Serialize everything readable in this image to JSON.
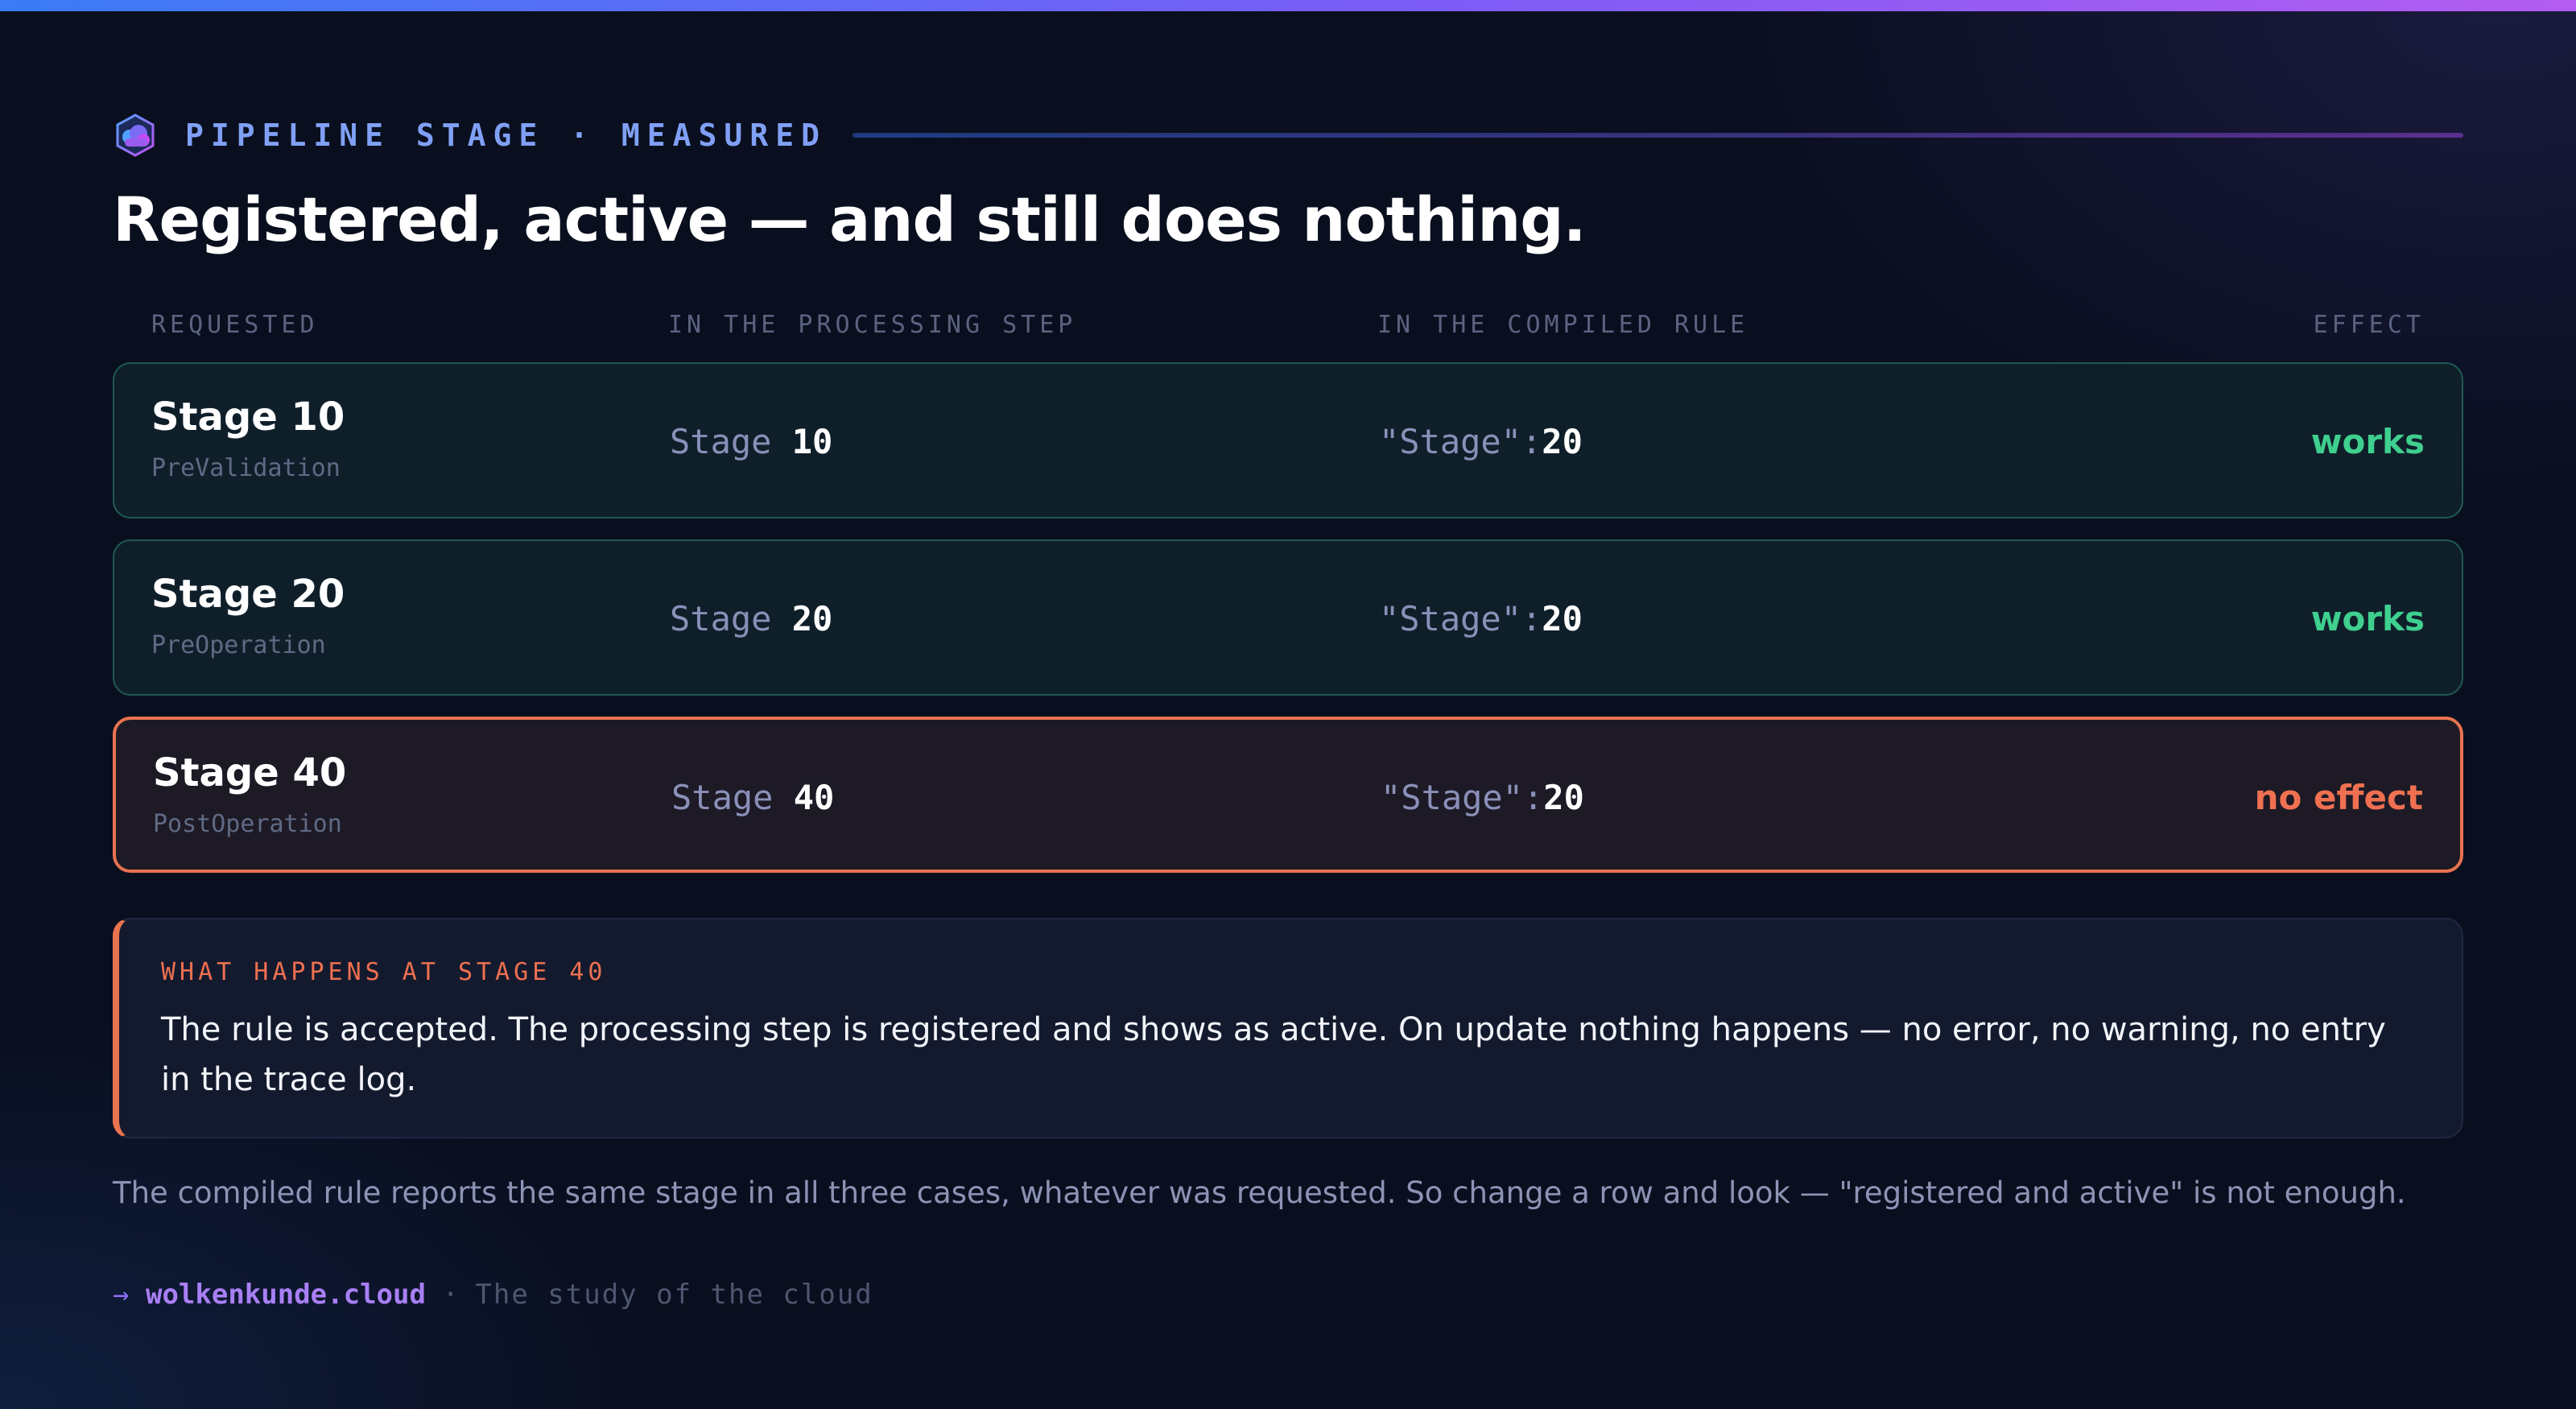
{
  "header": {
    "eyebrow": "PIPELINE STAGE · MEASURED",
    "title": "Registered, active — and still does nothing."
  },
  "table": {
    "columns": [
      "REQUESTED",
      "IN THE PROCESSING STEP",
      "IN THE COMPILED RULE",
      "EFFECT"
    ],
    "rows": [
      {
        "stage": "Stage 10",
        "sub": "PreValidation",
        "step_prefix": "Stage",
        "step_value": "10",
        "rule_prefix": "\"Stage\":",
        "rule_value": "20",
        "effect": "works",
        "status": "ok"
      },
      {
        "stage": "Stage 20",
        "sub": "PreOperation",
        "step_prefix": "Stage",
        "step_value": "20",
        "rule_prefix": "\"Stage\":",
        "rule_value": "20",
        "effect": "works",
        "status": "ok"
      },
      {
        "stage": "Stage 40",
        "sub": "PostOperation",
        "step_prefix": "Stage",
        "step_value": "40",
        "rule_prefix": "\"Stage\":",
        "rule_value": "20",
        "effect": "no effect",
        "status": "bad"
      }
    ]
  },
  "note": {
    "heading": "WHAT HAPPENS AT STAGE 40",
    "body": "The rule is accepted. The processing step is registered and shows as active. On update nothing happens — no error, no warning, no entry in the trace log."
  },
  "summary": "The compiled rule reports the same stage in all three cases, whatever was requested. So change a row and look — \"registered and active\" is not enough.",
  "footer": {
    "arrow": "→",
    "brand": "wolkenkunde.cloud",
    "separator": "·",
    "tagline": "The study of the cloud"
  },
  "colors": {
    "accent_good": "#3fcf8e",
    "accent_bad": "#ef7050",
    "brand": "#a97ff5",
    "background": "#0a0f1f"
  },
  "icons": {
    "logo": "cloud-logo-icon"
  }
}
